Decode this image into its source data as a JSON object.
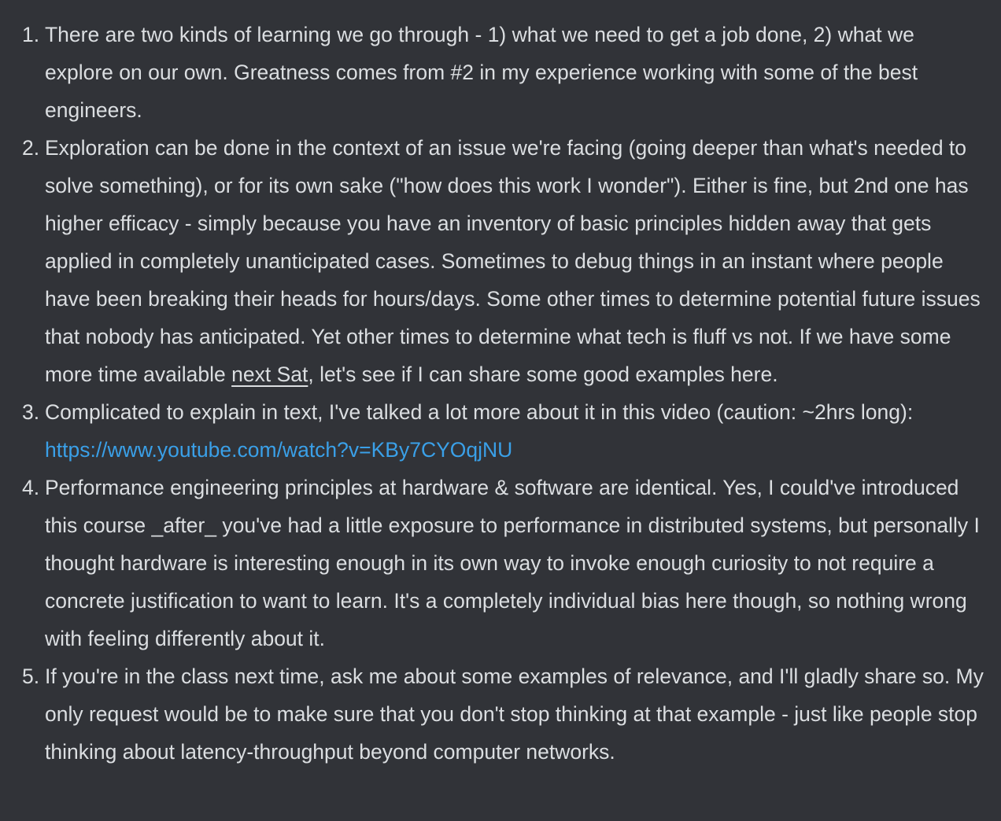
{
  "message": {
    "items": [
      {
        "number": "1.",
        "text": "There are two kinds of learning we go through - 1) what we need to get a job done, 2) what we explore on our own. Greatness comes from #2 in my experience working with some of the best engineers."
      },
      {
        "number": "2.",
        "text_before": "Exploration can be done in the context of an issue we're facing (going deeper than what's needed to solve something), or for its own sake (\"how does this work I wonder\"). Either is fine, but 2nd one has higher efficacy - simply because you have an inventory of basic principles hidden away that gets applied in completely unanticipated cases. Sometimes to debug things in an instant where people have been breaking their heads for hours/days. Some other times to determine potential future issues that nobody has anticipated. Yet other times to determine what tech is fluff vs not. If we have some more time available ",
        "date_mention": "next Sat",
        "text_after": ", let's see if I can share some good examples here."
      },
      {
        "number": "3.",
        "text_before": "Complicated to explain in text, I've talked a lot more about it in this video (caution: ~2hrs long): ",
        "link": "https://www.youtube.com/watch?v=KBy7CYOqjNU"
      },
      {
        "number": "4.",
        "text": "Performance engineering principles at hardware & software are identical. Yes, I could've introduced this course _after_ you've had a little exposure to performance in distributed systems, but personally I thought hardware is interesting enough in its own way to invoke enough curiosity to not require a concrete justification to want to learn. It's a completely individual bias here though, so nothing wrong with feeling differently about it."
      },
      {
        "number": "5.",
        "text": "If you're in the class next time, ask me about some examples of relevance, and I'll gladly share so. My only request would be to make sure that you don't stop thinking at that example - just like people stop thinking about latency-throughput beyond computer networks."
      }
    ]
  },
  "colors": {
    "background": "#313338",
    "text": "#dbdee1",
    "link": "#3aa0e8"
  }
}
